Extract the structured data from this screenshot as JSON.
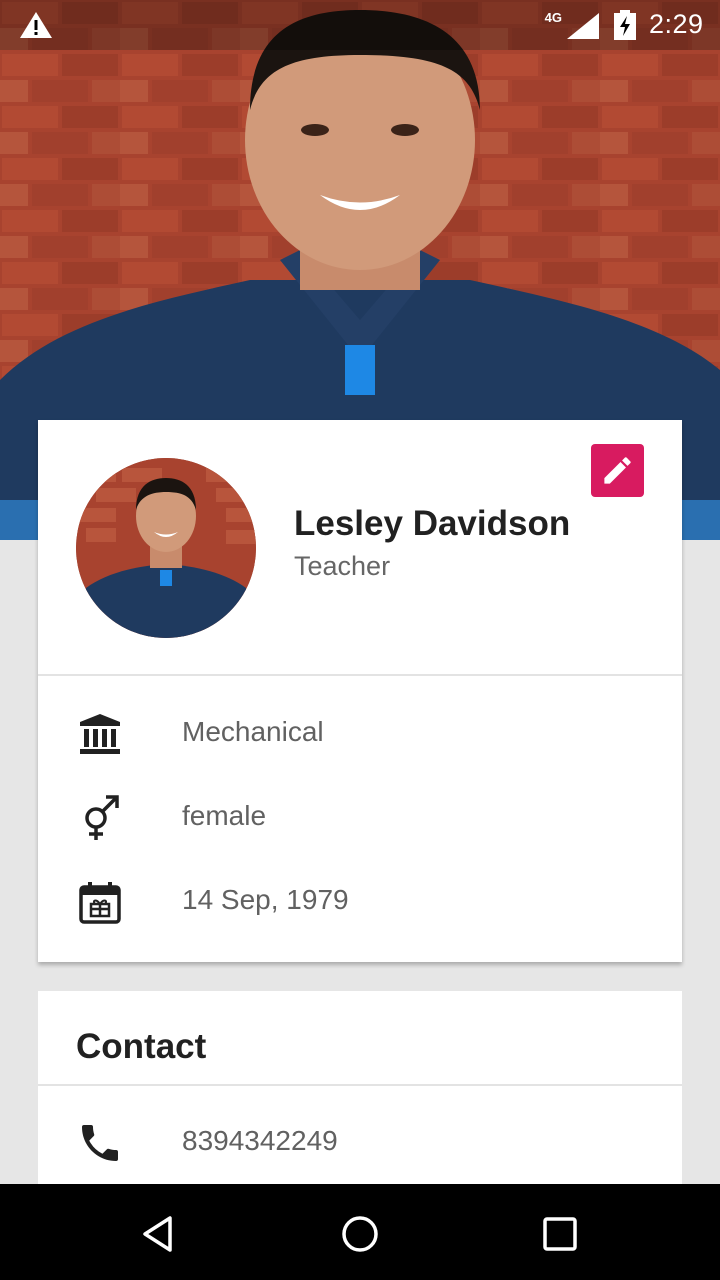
{
  "status_bar": {
    "network": "4G",
    "time": "2:29"
  },
  "profile": {
    "name": "Lesley Davidson",
    "role": "Teacher",
    "details": [
      {
        "icon": "bank-icon",
        "value": "Mechanical"
      },
      {
        "icon": "gender-icon",
        "value": "female"
      },
      {
        "icon": "birthday-calendar-icon",
        "value": "14 Sep, 1979"
      }
    ]
  },
  "contact": {
    "title": "Contact",
    "phone": "8394342249"
  },
  "colors": {
    "accent": "#d81b60",
    "brick": "#8d3a2b",
    "shirt": "#1f3a5f"
  }
}
